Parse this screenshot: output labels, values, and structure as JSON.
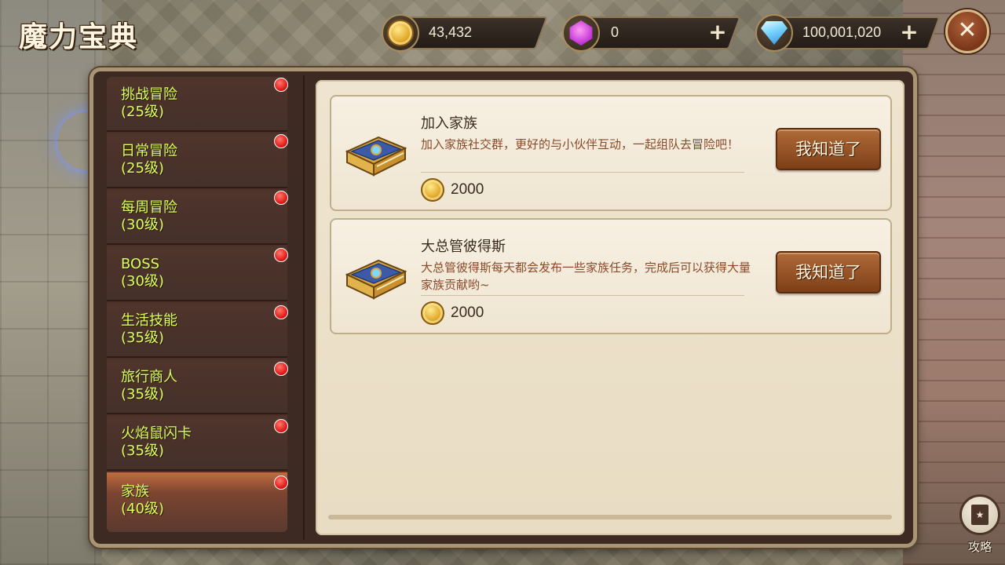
{
  "header": {
    "title": "魔力宝典"
  },
  "currencies": [
    {
      "name": "gold-coin",
      "value": "43,432",
      "has_plus": false
    },
    {
      "name": "purple-gem",
      "value": "0",
      "has_plus": true
    },
    {
      "name": "diamond",
      "value": "100,001,020",
      "has_plus": true
    }
  ],
  "sidebar": {
    "items": [
      {
        "label": "挑战冒险",
        "level": "(25级)",
        "active": false
      },
      {
        "label": "日常冒险",
        "level": "(25级)",
        "active": false
      },
      {
        "label": "每周冒险",
        "level": "(30级)",
        "active": false
      },
      {
        "label": "BOSS",
        "level": "(30级)",
        "active": false
      },
      {
        "label": "生活技能",
        "level": "(35级)",
        "active": false
      },
      {
        "label": "旅行商人",
        "level": "(35级)",
        "active": false
      },
      {
        "label": "火焰鼠闪卡",
        "level": "(35级)",
        "active": false
      },
      {
        "label": "家族",
        "level": "(40级)",
        "active": true
      }
    ]
  },
  "cards": [
    {
      "title": "加入家族",
      "description": "加入家族社交群，更好的与小伙伴互动，一起组队去冒险吧！",
      "reward": "2000",
      "button": "我知道了"
    },
    {
      "title": "大总管彼得斯",
      "description": "大总管彼得斯每天都会发布一些家族任务，完成后可以获得大量家族贡献哟~",
      "reward": "2000",
      "button": "我知道了"
    }
  ],
  "guide": {
    "label": "攻略"
  },
  "icons": {
    "close": "close-icon",
    "coin": "coin-icon",
    "gem": "gem-icon",
    "diamond": "diamond-icon",
    "plus": "plus-icon",
    "notification": "red-dot-icon",
    "book": "book-icon"
  },
  "colors": {
    "sidebar_text": "#d8ff5c",
    "description_text": "#8b4a2a",
    "button": "#9a5428",
    "notification": "#e01616"
  }
}
